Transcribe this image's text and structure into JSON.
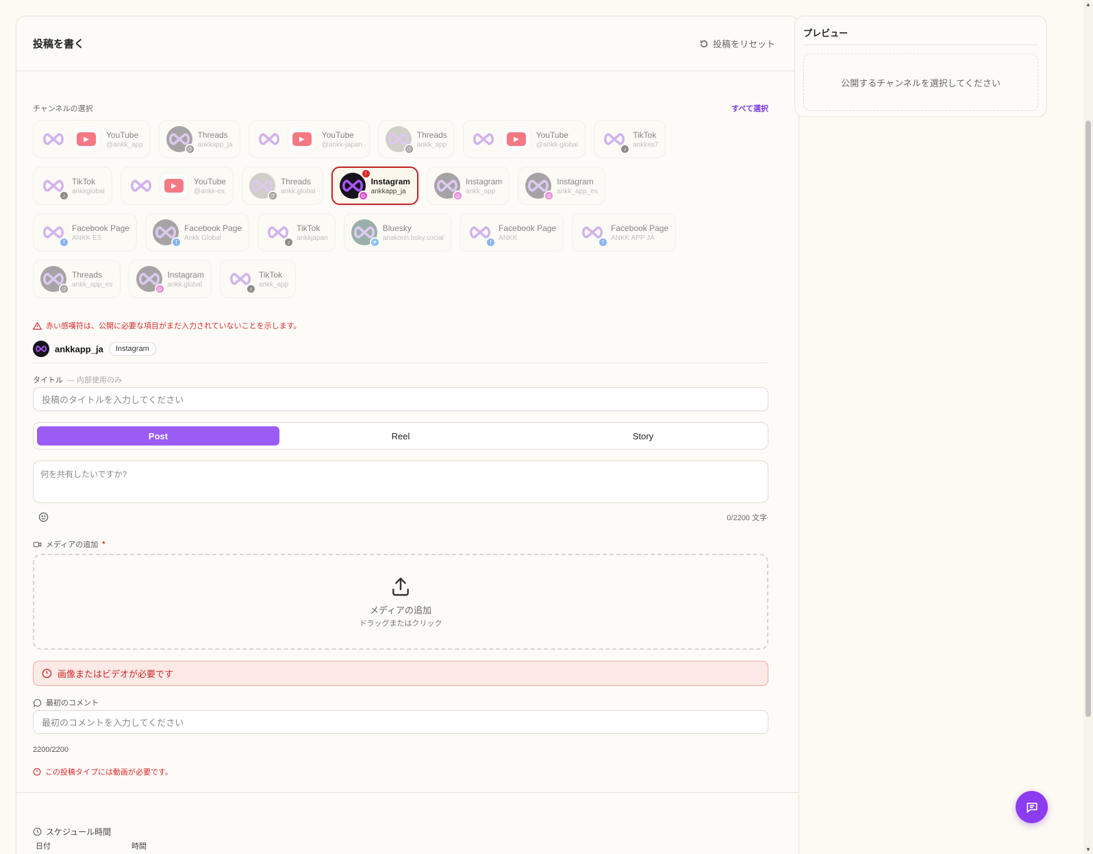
{
  "header": {
    "title": "投稿を書く",
    "reset_label": "投稿をリセット"
  },
  "channels": {
    "section_label": "チャンネルの選択",
    "select_all": "すべて選択",
    "rows": [
      [
        {
          "name": "YouTube",
          "handle": "@ankk_app",
          "avatar": "logo",
          "platform": "youtube"
        },
        {
          "name": "Threads",
          "handle": "ankkapp_ja",
          "avatar": "gray",
          "platform": "threads"
        },
        {
          "name": "YouTube",
          "handle": "@ankk-japan",
          "avatar": "logo",
          "platform": "youtube"
        },
        {
          "name": "Threads",
          "handle": "ankk_app",
          "avatar": "photo",
          "platform": "threads"
        },
        {
          "name": "YouTube",
          "handle": "@ankk-global",
          "avatar": "logo",
          "platform": "youtube"
        },
        {
          "name": "TikTok",
          "handle": "ankkes7",
          "avatar": "logo",
          "platform": "tiktok"
        }
      ],
      [
        {
          "name": "TikTok",
          "handle": "ankkglobal",
          "avatar": "logo",
          "platform": "tiktok"
        },
        {
          "name": "YouTube",
          "handle": "@ankk-es",
          "avatar": "logo",
          "platform": "youtube"
        },
        {
          "name": "Threads",
          "handle": "ankk.global",
          "avatar": "photo",
          "platform": "threads"
        },
        {
          "name": "Instagram",
          "handle": "ankkapp_ja",
          "avatar": "dark",
          "platform": "insta",
          "selected": true
        },
        {
          "name": "Instagram",
          "handle": "ankk_app",
          "avatar": "gray",
          "platform": "insta"
        },
        {
          "name": "Instagram",
          "handle": "ankk_app_es",
          "avatar": "gray",
          "platform": "insta"
        }
      ],
      [
        {
          "name": "Facebook Page",
          "handle": "ANKK ES",
          "avatar": "logo",
          "platform": "fb"
        },
        {
          "name": "Facebook Page",
          "handle": "Ankk Global",
          "avatar": "gray",
          "platform": "fb"
        },
        {
          "name": "TikTok",
          "handle": "ankkjapan",
          "avatar": "logo",
          "platform": "tiktok"
        },
        {
          "name": "Bluesky",
          "handle": "anakonn.bsky.social",
          "avatar": "teal",
          "platform": "bsky"
        },
        {
          "name": "Facebook Page",
          "handle": "ANKK",
          "avatar": "logo",
          "platform": "fb"
        },
        {
          "name": "Facebook Page",
          "handle": "ANKK APP JA",
          "avatar": "logo",
          "platform": "fb"
        }
      ],
      [
        {
          "name": "Threads",
          "handle": "ankk_app_es",
          "avatar": "gray",
          "platform": "threads"
        },
        {
          "name": "Instagram",
          "handle": "ankk.global",
          "avatar": "gray",
          "platform": "insta"
        },
        {
          "name": "TikTok",
          "handle": "ankk_app",
          "avatar": "logo",
          "platform": "tiktok"
        }
      ]
    ],
    "warning": "赤い感嘆符は、公開に必要な項目がまだ入力されていないことを示します。"
  },
  "account": {
    "name": "ankkapp_ja",
    "platform_chip": "Instagram"
  },
  "title_field": {
    "label": "タイトル",
    "sublabel": "— 内部使用のみ",
    "placeholder": "投稿のタイトルを入力してください"
  },
  "post_types": {
    "tabs": [
      "Post",
      "Reel",
      "Story"
    ],
    "active": "Post"
  },
  "body_field": {
    "placeholder": "何を共有したいですか?",
    "counter": "0/2200 文字"
  },
  "media": {
    "label": "メディアの追加",
    "required_mark": "*",
    "drop_title": "メディアの追加",
    "drop_sub": "ドラッグまたはクリック",
    "alert": "画像またはビデオが必要です"
  },
  "first_comment": {
    "label": "最初のコメント",
    "placeholder": "最初のコメントを入力してください",
    "counter": "2200/2200",
    "error": "この投稿タイプには動画が必要です。"
  },
  "schedule": {
    "label": "スケジュール時間",
    "date_label": "日付",
    "time_label": "時間"
  },
  "preview": {
    "title": "プレビュー",
    "empty": "公開するチャンネルを選択してください"
  },
  "colors": {
    "accent": "#9b5cf6",
    "error": "#d72c2c",
    "fab": "#8b3cf0"
  }
}
